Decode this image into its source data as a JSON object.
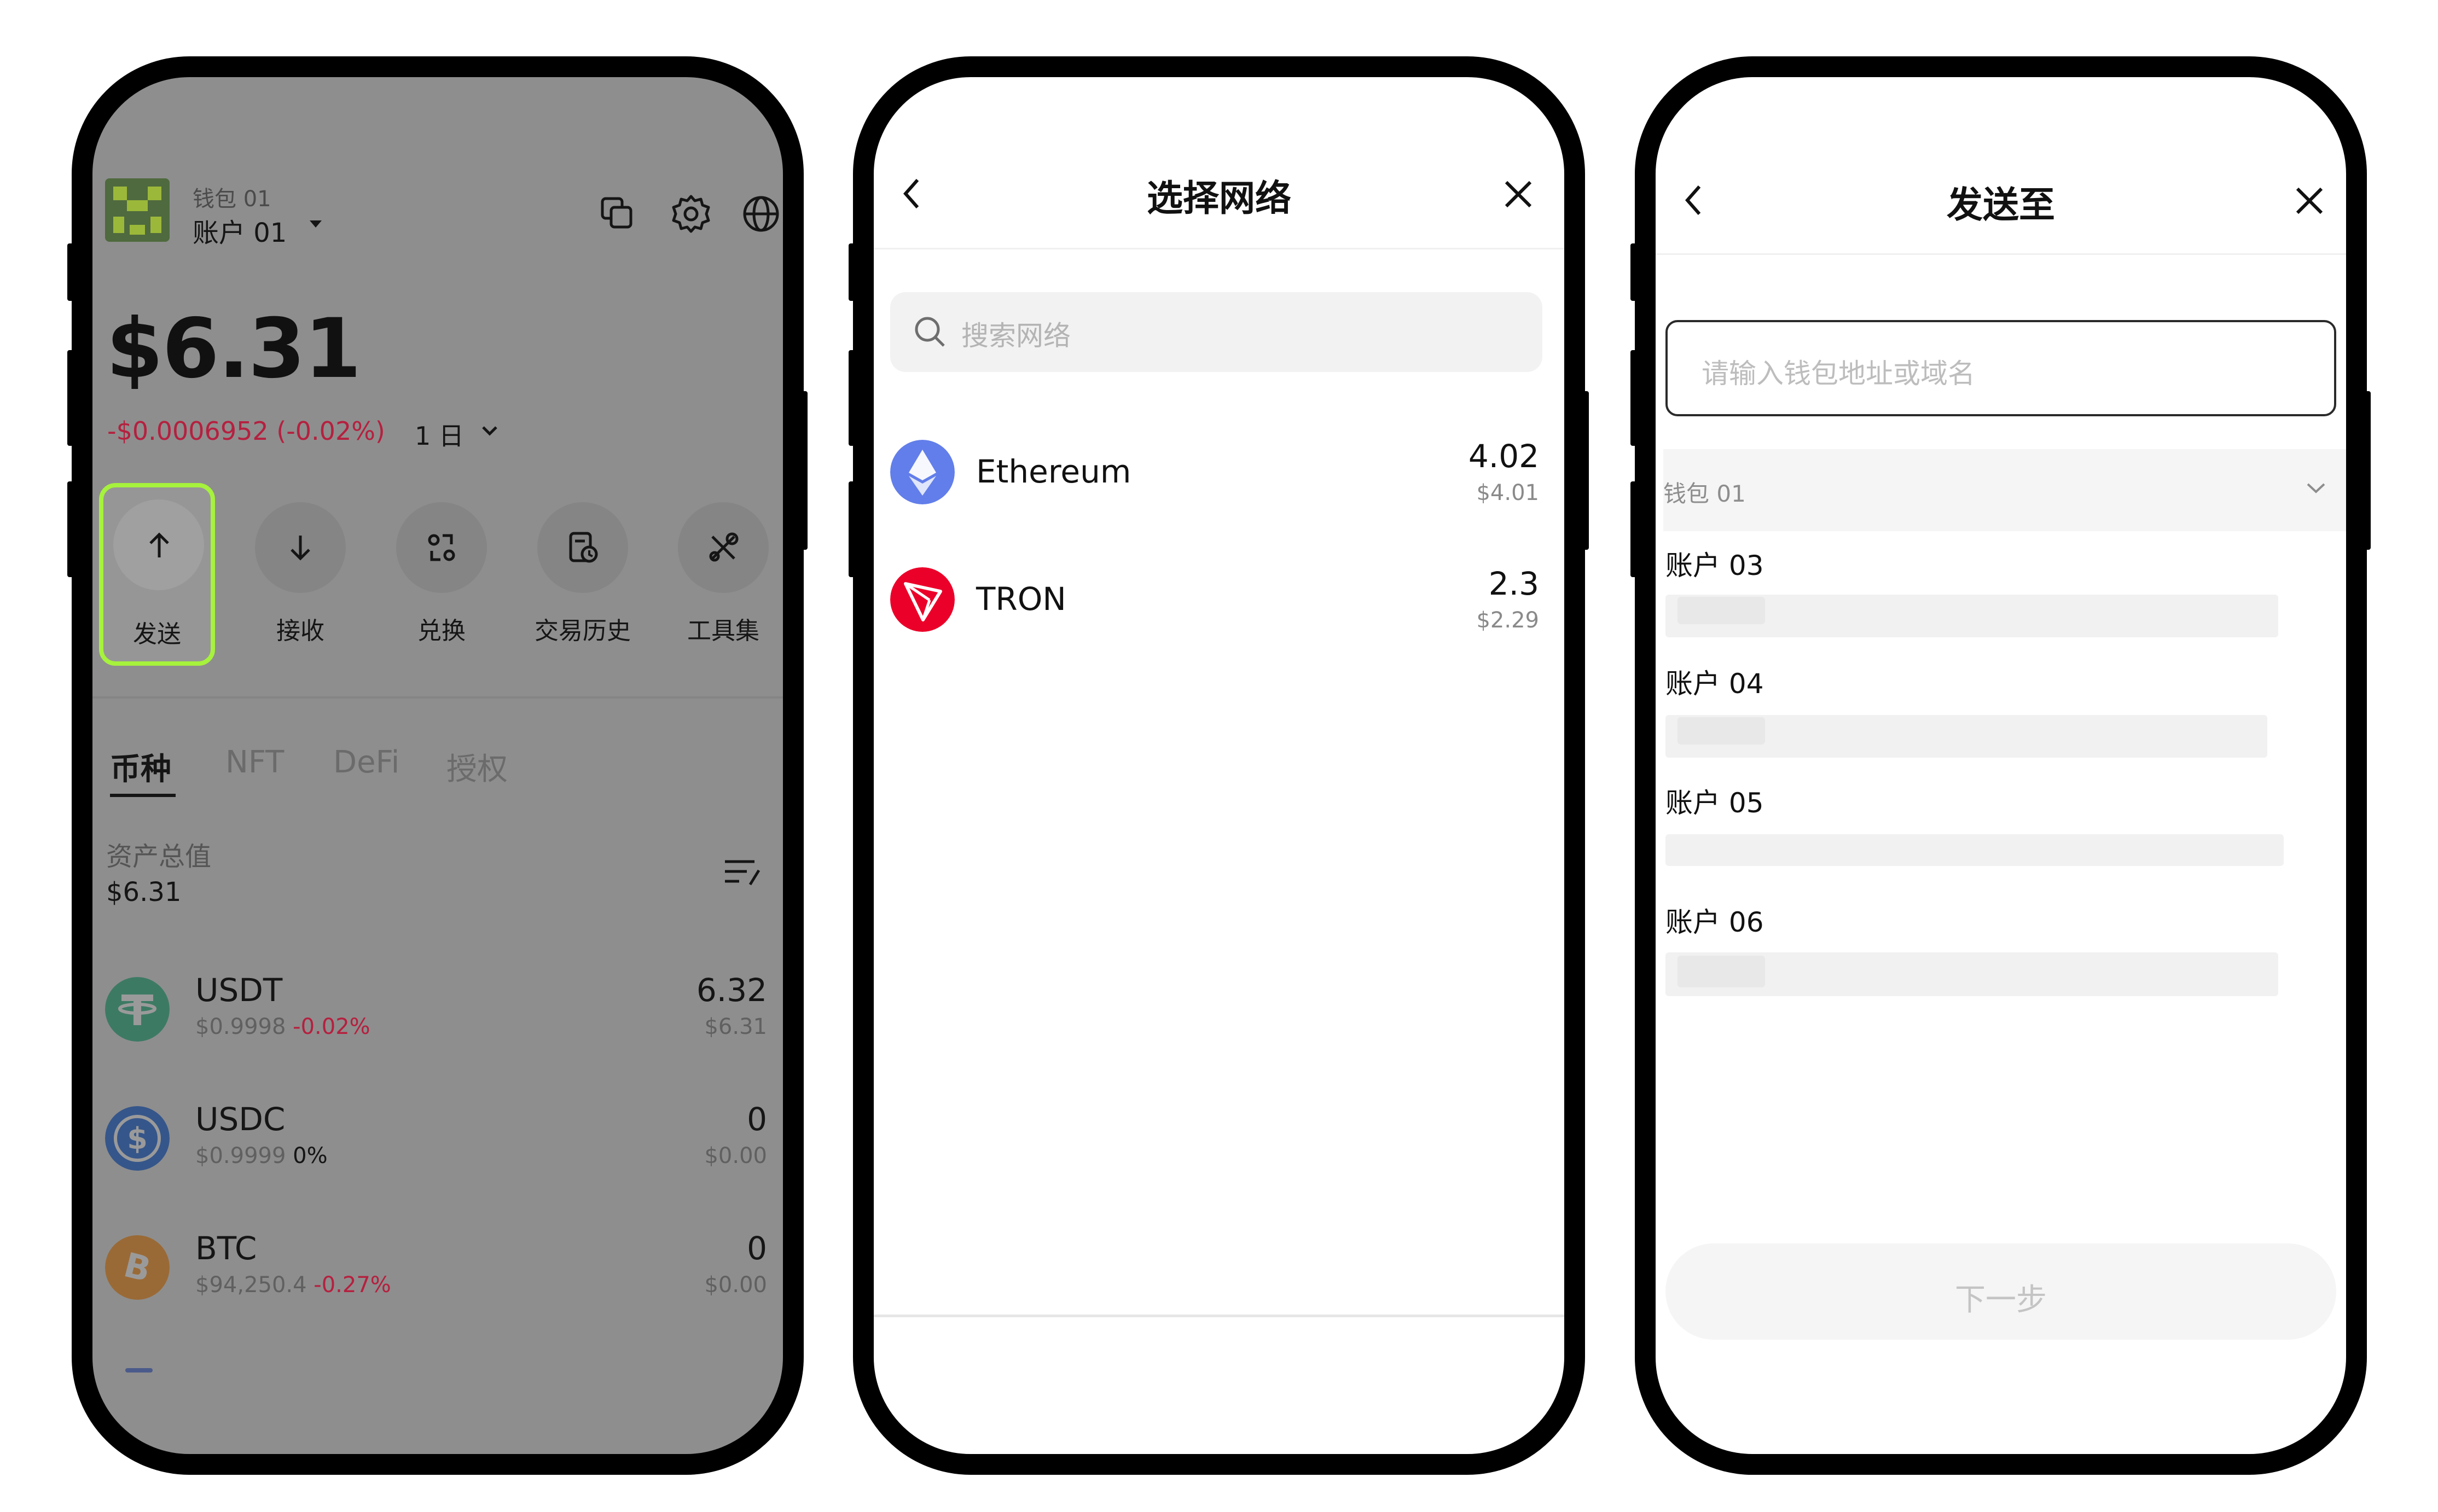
{
  "wallet_home": {
    "wallet_label": "钱包 01",
    "account_label": "账户 01",
    "balance": "$6.31",
    "change": "-$0.0006952 (-0.02%)",
    "period": "1 日",
    "actions": [
      {
        "label": "发送",
        "icon": "arrow-up-icon",
        "highlighted": true
      },
      {
        "label": "接收",
        "icon": "arrow-down-icon"
      },
      {
        "label": "兑换",
        "icon": "swap-icon"
      },
      {
        "label": "交易历史",
        "icon": "history-icon"
      },
      {
        "label": "工具集",
        "icon": "tools-icon"
      }
    ],
    "highlight_color": "#a6f23c",
    "tabs": [
      "币种",
      "NFT",
      "DeFi",
      "授权"
    ],
    "active_tab": "币种",
    "total_label": "资产总值",
    "total_value": "$6.31",
    "tokens": [
      {
        "symbol": "USDT",
        "price": "$0.9998",
        "change": "-0.02%",
        "amount": "6.32",
        "usd": "$6.31",
        "color": "#26a17b"
      },
      {
        "symbol": "USDC",
        "price": "$0.9999",
        "change": "0%",
        "amount": "0",
        "usd": "$0.00",
        "color": "#2775ca"
      },
      {
        "symbol": "BTC",
        "price": "$94,250.4",
        "change": "-0.27%",
        "amount": "0",
        "usd": "$0.00",
        "color": "#f7931a"
      }
    ]
  },
  "select_network": {
    "title": "选择网络",
    "search_placeholder": "搜索网络",
    "networks": [
      {
        "name": "Ethereum",
        "amount": "4.02",
        "usd": "$4.01",
        "color": "#627eea"
      },
      {
        "name": "TRON",
        "amount": "2.3",
        "usd": "$2.29",
        "color": "#eb0029"
      }
    ]
  },
  "send_to": {
    "title": "发送至",
    "address_placeholder": "请输入钱包地址或域名",
    "wallet_group": "钱包 01",
    "accounts": [
      "账户 03",
      "账户 04",
      "账户 05",
      "账户 06"
    ],
    "next_label": "下一步"
  }
}
